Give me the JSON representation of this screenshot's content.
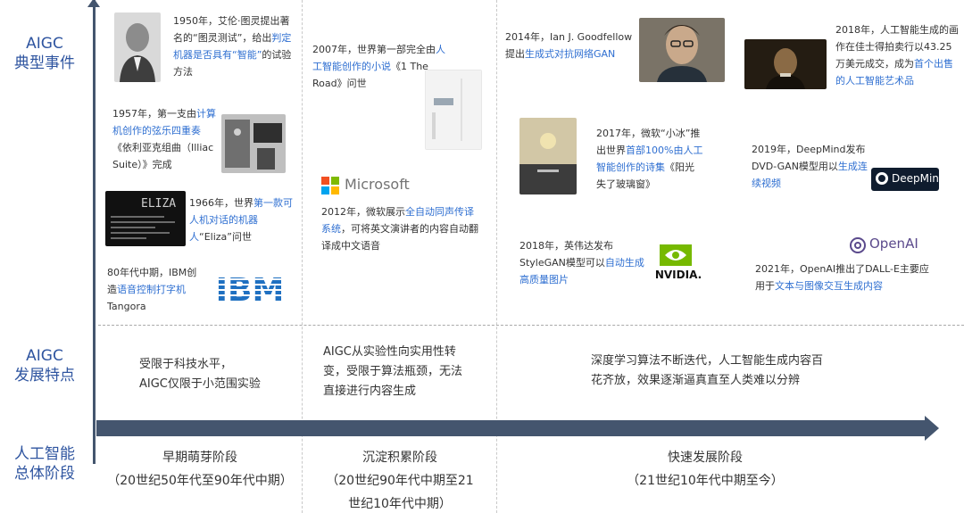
{
  "labels": {
    "events": [
      "AIGC",
      "典型事件"
    ],
    "features": [
      "AIGC",
      "发展特点"
    ],
    "stages": [
      "人工智能",
      "总体阶段"
    ]
  },
  "events": {
    "e1950": {
      "pre": "1950年，艾伦·图灵提出著名的“图灵测试”，给出",
      "hl": "判定机器是否具有“智能”",
      "post": "的试验方法"
    },
    "e1957": {
      "pre": "1957年，第一支由",
      "hl": "计算机创作的弦乐四重奏",
      "post": "《依利亚克组曲（Illiac Suite）》完成"
    },
    "e1966": {
      "pre": "1966年，世界",
      "hl": "第一款可人机对话的机器人",
      "post": "“Eliza”问世"
    },
    "e80s": {
      "pre": "80年代中期，IBM创造",
      "hl": "语音控制打字机",
      "post": "Tangora"
    },
    "e2007": {
      "pre": "2007年，世界第一部完全由",
      "hl": "人工智能创作的小说",
      "post": "《1 The Road》问世"
    },
    "e2012": {
      "pre": "2012年，微软展示",
      "hl": "全自动同声传译系统",
      "post": "，可将英文演讲者的内容自动翻译成中文语音"
    },
    "e2014": {
      "pre": "2014年，Ian J. Goodfellow提出",
      "hl": "生成式对抗网络GAN",
      "post": ""
    },
    "e2017": {
      "pre": "2017年，微软“小冰”推出世界",
      "hl": "首部100%由人工智能创作的诗集",
      "post": "《阳光失了玻璃窗》"
    },
    "e2018a": {
      "pre": "2018年，英伟达发布StyleGAN模型可以",
      "hl": "自动生成高质量图片",
      "post": ""
    },
    "e2018b": {
      "pre": "2018年，人工智能生成的画作在佳士得拍卖行以43.25万美元成交，成为",
      "hl": "首个出售的人工智能艺术品",
      "post": ""
    },
    "e2019": {
      "pre": "2019年，DeepMind发布DVD-GAN模型用以",
      "hl": "生成连续视频",
      "post": ""
    },
    "e2021": {
      "pre": "2021年，OpenAI推出了DALL-E主要应用于",
      "hl": "文本与图像交互生成内容",
      "post": ""
    }
  },
  "brands": {
    "microsoft": "Microsoft",
    "ibm": "IBM",
    "nvidia": "NVIDIA.",
    "deepmind": "DeepMind",
    "openai": "OpenAI",
    "eliza": "ELIZA"
  },
  "features": {
    "f1": [
      "受限于科技水平，",
      "AIGC仅限于小范围实验"
    ],
    "f2": [
      "AIGC从实验性向实用性转",
      "变，受限于算法瓶颈，无法",
      "直接进行内容生成"
    ],
    "f3": [
      "深度学习算法不断迭代，人工智能生成内容百",
      "花齐放，效果逐渐逼真直至人类难以分辨"
    ]
  },
  "stages": {
    "s1": {
      "name": "早期萌芽阶段",
      "period": "（20世纪50年代至90年代中期）"
    },
    "s2": {
      "name": "沉淀积累阶段",
      "period": [
        "（20世纪90年代中期至21",
        "世纪10年代中期）"
      ]
    },
    "s3": {
      "name": "快速发展阶段",
      "period": "（21世纪10年代中期至今）"
    }
  },
  "colors": {
    "axis": "#44556e",
    "label": "#2f55a0",
    "highlight": "#2f6fd1",
    "nvidia": "#76b900",
    "ibm": "#1f70c1"
  }
}
